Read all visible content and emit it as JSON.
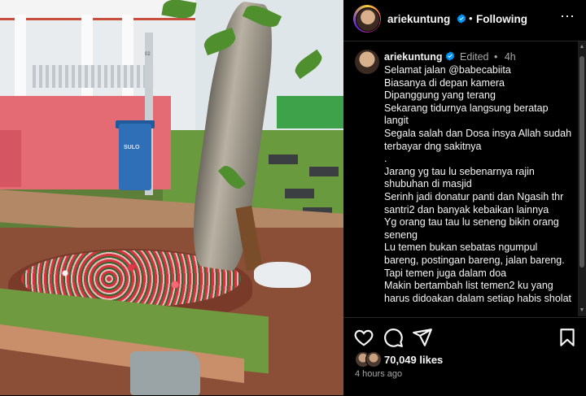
{
  "post": {
    "username": "ariekuntung",
    "follow_status": "Following",
    "separator": "•",
    "more_label": "⋯"
  },
  "caption": {
    "username": "ariekuntung",
    "edited": "Edited",
    "separator": "•",
    "time": "4h",
    "text": "Selamat jalan @babecabiita\nBiasanya di depan kamera\nDipanggung yang terang\nSekarang tidurnya langsung beratap langit\nSegala salah dan Dosa insya Allah sudah terbayar dng sakitnya\n.\nJarang yg tau lu sebenarnya rajin shubuhan di masjid\nSerinh jadi donatur panti dan Ngasih thr santri2 dan banyak kebaikan lainnya\nYg orang tau tau lu seneng bikin orang seneng\nLu temen bukan sebatas ngumpul bareng, postingan bareng, jalan bareng. Tapi temen juga dalam doa\nMakin bertambah list temen2 ku yang harus didoakan dalam setiap habis sholat"
  },
  "photo": {
    "bin_label": "SULO",
    "pole_label": "02"
  },
  "engagement": {
    "likes": "70,049 likes",
    "time_ago": "4 hours ago"
  },
  "icons": {
    "like": "heart-icon",
    "comment": "comment-icon",
    "share": "share-icon",
    "save": "bookmark-icon",
    "verified": "verified-badge-icon",
    "more": "more-options-icon"
  },
  "colors": {
    "background": "#000000",
    "text": "#f5f5f5",
    "secondary_text": "#a8a8a8",
    "verified": "#0095f6"
  }
}
